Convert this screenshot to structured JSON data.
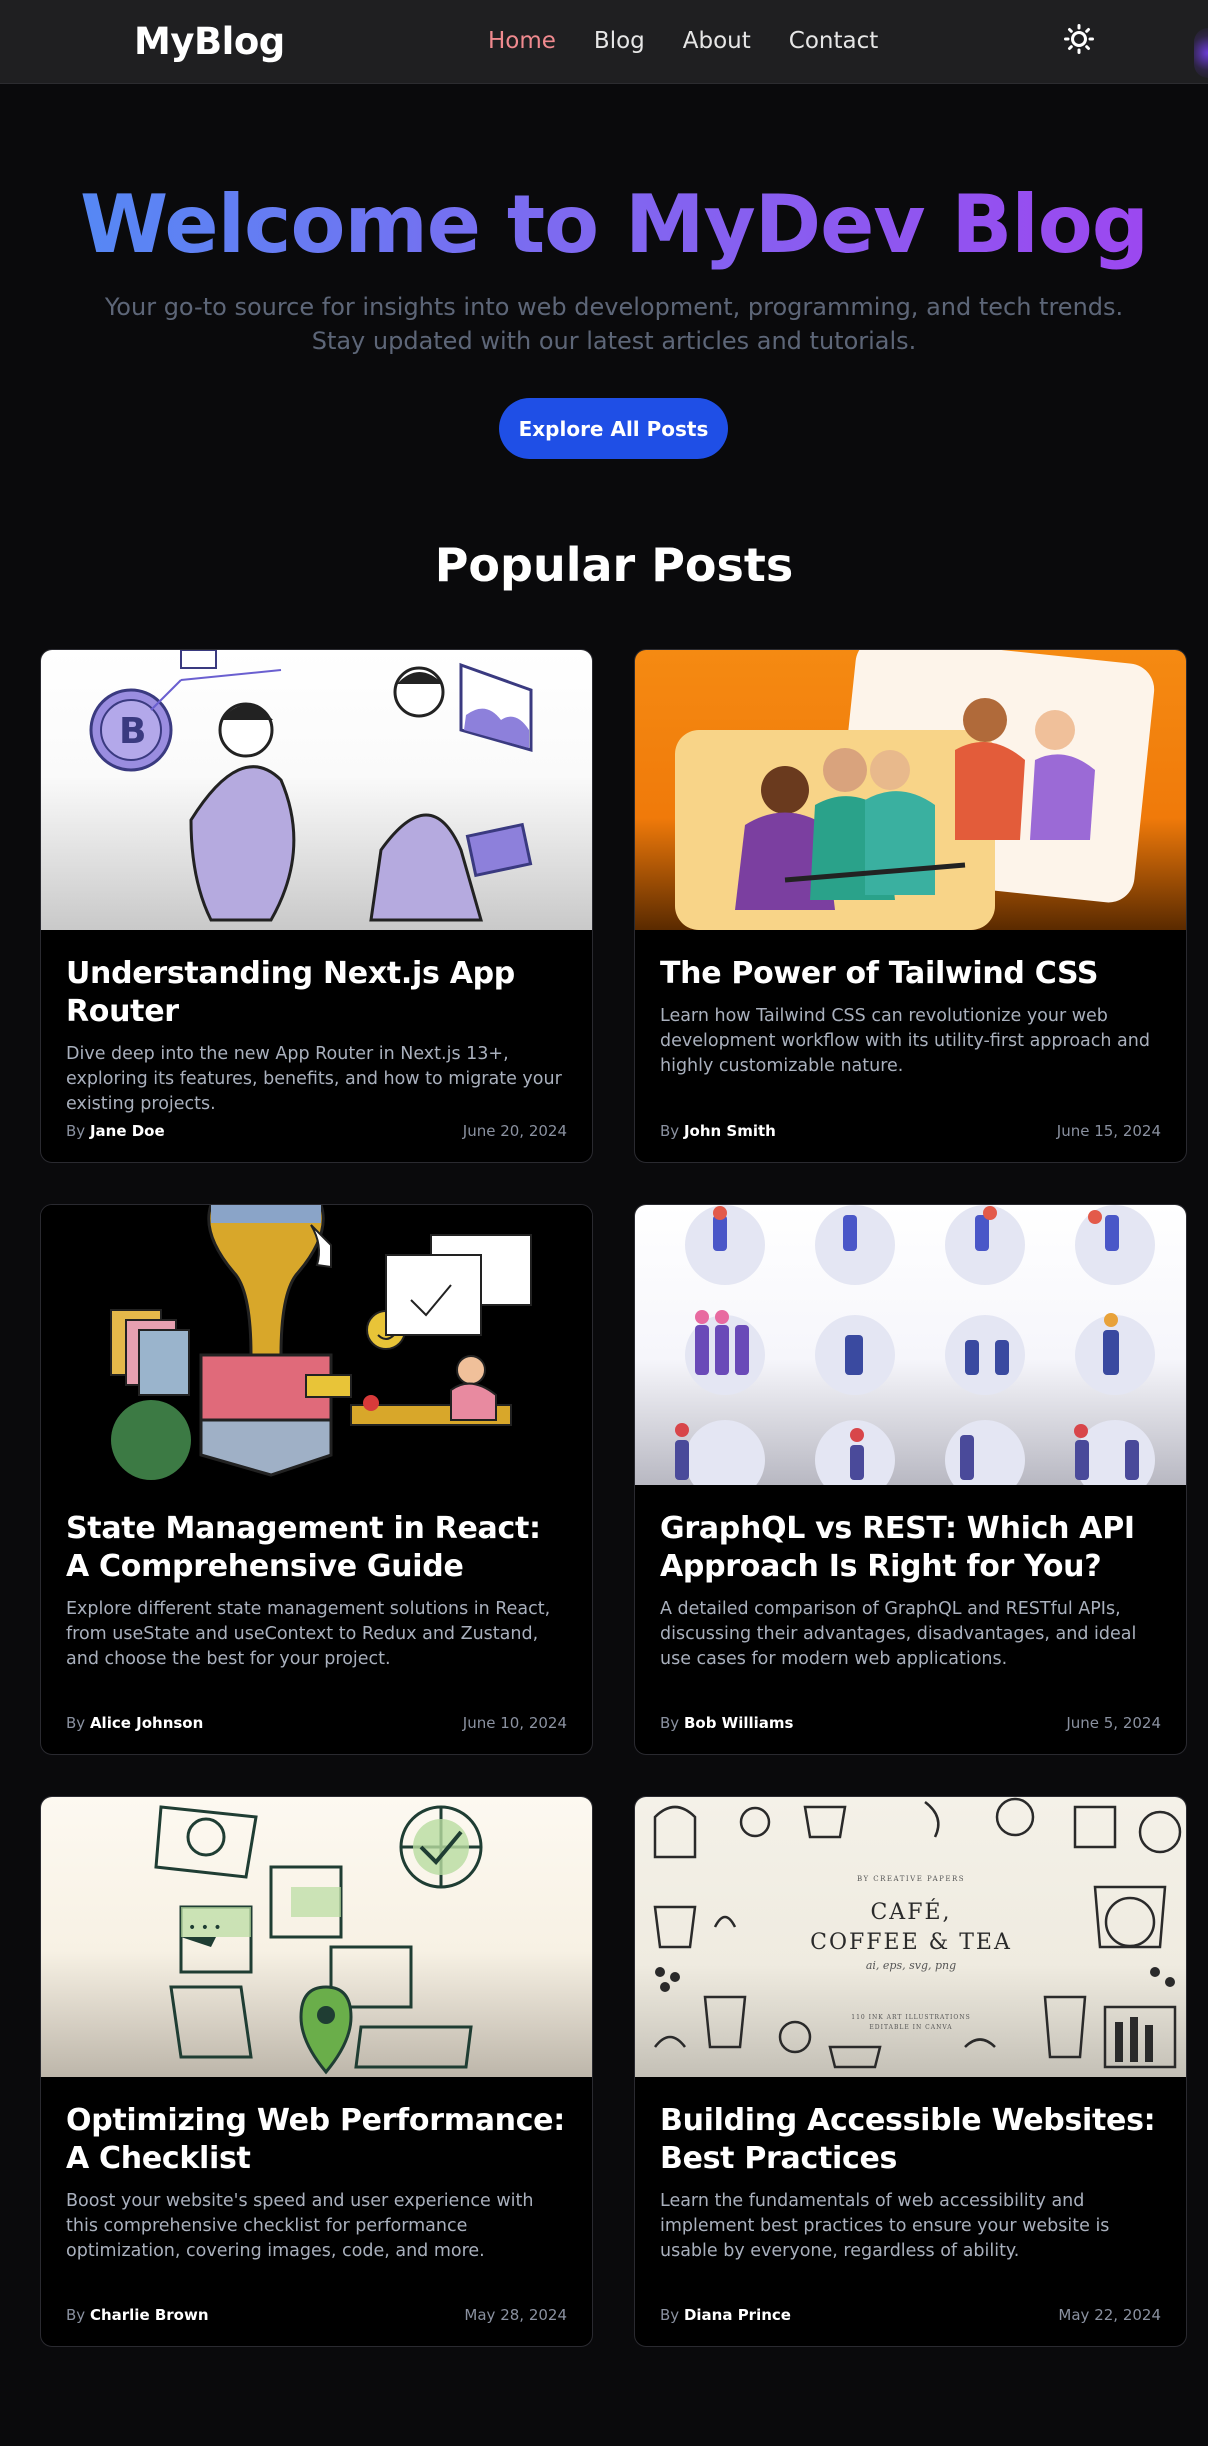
{
  "nav": {
    "brand": "MyBlog",
    "links": [
      "Home",
      "Blog",
      "About",
      "Contact"
    ],
    "active": "Home",
    "theme_icon": "sun-icon"
  },
  "hero": {
    "title": "Welcome to MyDev Blog",
    "subtitle_line1": "Your go-to source for insights into web development, programming, and tech trends.",
    "subtitle_line2": "Stay updated with our latest articles and tutorials.",
    "cta": "Explore All Posts"
  },
  "popular": {
    "title": "Popular Posts",
    "by_prefix": "By",
    "posts": [
      {
        "title": "Understanding Next.js App Router",
        "excerpt": "Dive deep into the new App Router in Next.js 13+, exploring its features, benefits, and how to migrate your existing projects.",
        "author": "Jane Doe",
        "date": "June 20, 2024"
      },
      {
        "title": "The Power of Tailwind CSS",
        "excerpt": "Learn how Tailwind CSS can revolutionize your web development workflow with its utility-first approach and highly customizable nature.",
        "author": "John Smith",
        "date": "June 15, 2024"
      },
      {
        "title": "State Management in React: A Comprehensive Guide",
        "excerpt": "Explore different state management solutions in React, from useState and useContext to Redux and Zustand, and choose the best for your project.",
        "author": "Alice Johnson",
        "date": "June 10, 2024"
      },
      {
        "title": "GraphQL vs REST: Which API Approach Is Right for You?",
        "excerpt": "A detailed comparison of GraphQL and RESTful APIs, discussing their advantages, disadvantages, and ideal use cases for modern web applications.",
        "author": "Bob Williams",
        "date": "June 5, 2024"
      },
      {
        "title": "Optimizing Web Performance: A Checklist",
        "excerpt": "Boost your website's speed and user experience with this comprehensive checklist for performance optimization, covering images, code, and more.",
        "author": "Charlie Brown",
        "date": "May 28, 2024"
      },
      {
        "title": "Building Accessible Websites: Best Practices",
        "excerpt": "Learn the fundamentals of web accessibility and implement best practices to ensure your website is usable by everyone, regardless of ability.",
        "author": "Diana Prince",
        "date": "May 22, 2024"
      }
    ]
  },
  "images": {
    "post6": {
      "kicker": "BY CREATIVE PAPERS",
      "line1": "CAFÉ,",
      "line2": "COFFEE & TEA",
      "formats": "ai, eps, svg, png",
      "footer1": "110 INK ART ILLUSTRATIONS",
      "footer2": "EDITABLE IN CANVA"
    }
  }
}
